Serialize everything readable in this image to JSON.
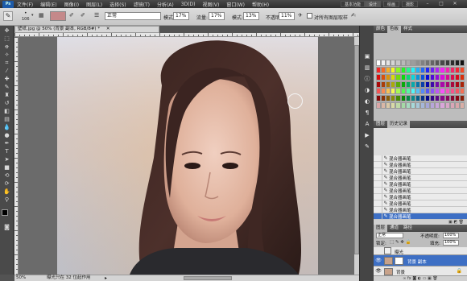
{
  "menubar": {
    "app_logo": "Ps",
    "items": [
      "文件(F)",
      "编辑(E)",
      "图像(I)",
      "图层(L)",
      "选择(S)",
      "滤镜(T)",
      "分析(A)",
      "3D(D)",
      "视图(V)",
      "窗口(W)",
      "帮助(H)"
    ],
    "workspaces": [
      "设计",
      "绘画",
      "摄影"
    ],
    "basic_features": "基本功能"
  },
  "options": {
    "brush_size": "106",
    "mode_label": "模式:",
    "mode_value": "正常",
    "opacity_label": "不透明度:",
    "opacity_value": "17%",
    "flow_label": "流量:",
    "flow_value": "17%",
    "mode2_label": "模式:",
    "opacity2_value": "13%",
    "flow2_value": "11%",
    "sample_all_layers": "对所有图层取样"
  },
  "document": {
    "tab_title": "壁纸.jpg @ 50% (背景 副本, RGB/8#) *",
    "zoom": "50%",
    "status_text": "曝光只在 32 位起作用"
  },
  "panels": {
    "color_tabs": [
      "颜色",
      "色板",
      "样式"
    ],
    "history_tabs": [
      "图层",
      "历史记录"
    ],
    "history_items": [
      "混合器画笔",
      "混合器画笔",
      "混合器画笔",
      "混合器画笔",
      "混合器画笔",
      "混合器画笔",
      "混合器画笔",
      "混合器画笔",
      "混合器画笔",
      "混合器画笔"
    ],
    "layer_tabs": [
      "图层",
      "通道",
      "路径"
    ],
    "blend_mode": "正常",
    "opacity_label": "不透明度:",
    "opacity_value": "100%",
    "lock_label": "锁定:",
    "fill_label": "填充:",
    "fill_value": "100%",
    "layers": [
      {
        "name": "曝光"
      },
      {
        "name": "背景 副本"
      },
      {
        "name": "背景"
      }
    ]
  },
  "colors": {
    "selection": "#3d6fc4",
    "foreground": "#000000",
    "background": "#ffffff"
  }
}
